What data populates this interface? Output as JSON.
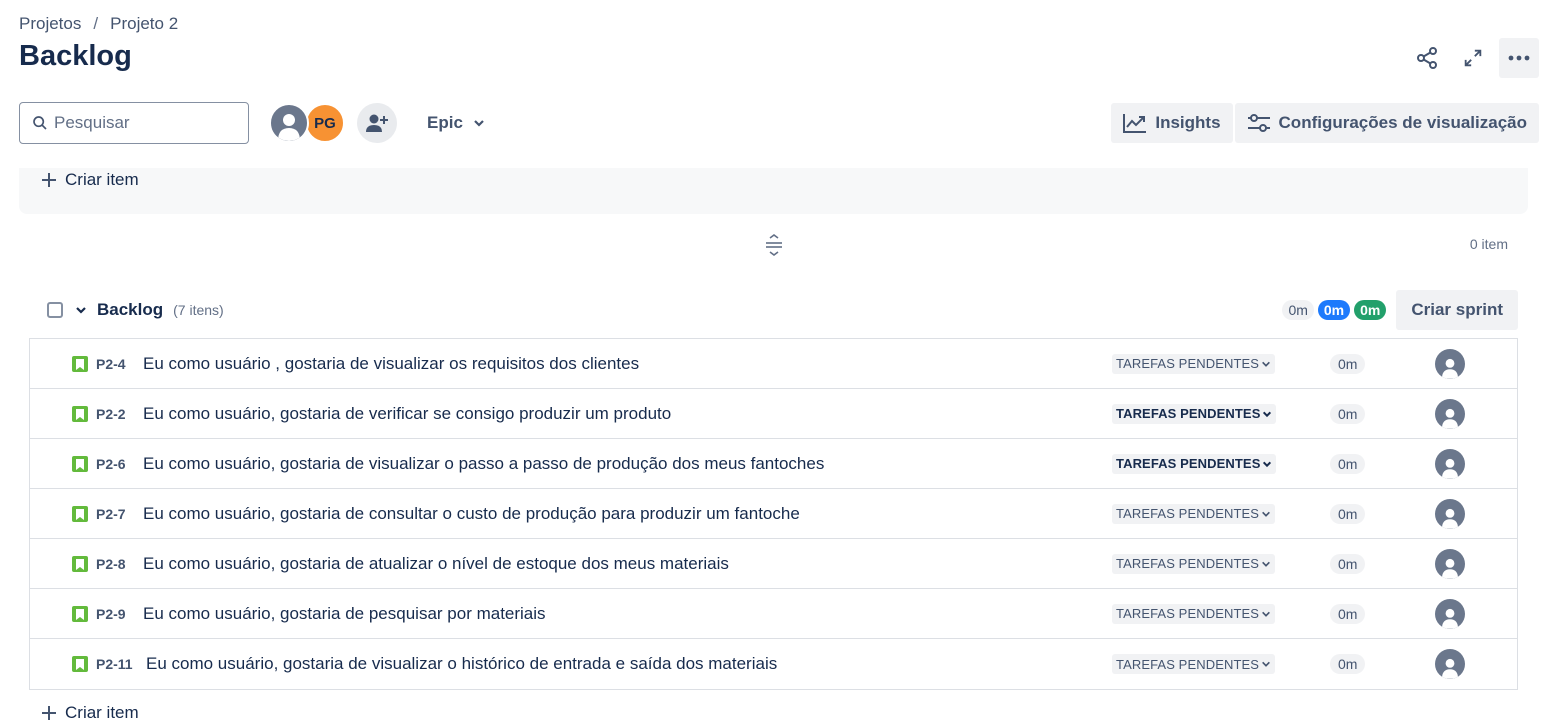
{
  "breadcrumb": {
    "projects": "Projetos",
    "separator": "/",
    "project": "Projeto 2"
  },
  "page": {
    "title": "Backlog"
  },
  "toolbar": {
    "search_placeholder": "Pesquisar",
    "avatar_initials": "PG",
    "epic_label": "Epic",
    "insights_label": "Insights",
    "view_settings_label": "Configurações de visualização"
  },
  "sprint_panel": {
    "create_item_label": "Criar item",
    "item_count": "0 item"
  },
  "backlog": {
    "title": "Backlog",
    "count": "(7 itens)",
    "estimate_todo": "0m",
    "estimate_in_progress": "0m",
    "estimate_done": "0m",
    "create_sprint_label": "Criar sprint",
    "create_item_label": "Criar item",
    "issues": [
      {
        "key": "P2-4",
        "summary": "Eu como usuário , gostaria de visualizar os requisitos dos clientes",
        "status": "TAREFAS PENDENTES",
        "estimate": "0m"
      },
      {
        "key": "P2-2",
        "summary": "Eu como usuário, gostaria de verificar se consigo produzir um produto",
        "status": "TAREFAS PENDENTES",
        "estimate": "0m"
      },
      {
        "key": "P2-6",
        "summary": "Eu como usuário, gostaria de visualizar o passo a passo de produção dos meus fantoches",
        "status": "TAREFAS PENDENTES",
        "estimate": "0m"
      },
      {
        "key": "P2-7",
        "summary": "Eu como usuário, gostaria de consultar o custo de produção para produzir um fantoche",
        "status": "TAREFAS PENDENTES",
        "estimate": "0m"
      },
      {
        "key": "P2-8",
        "summary": "Eu como usuário, gostaria de atualizar o nível de estoque dos meus materiais",
        "status": "TAREFAS PENDENTES",
        "estimate": "0m"
      },
      {
        "key": "P2-9",
        "summary": "Eu como usuário, gostaria de pesquisar por materiais",
        "status": "TAREFAS PENDENTES",
        "estimate": "0m"
      },
      {
        "key": "P2-11",
        "summary": "Eu como usuário, gostaria de visualizar o histórico de entrada e saída dos materiais",
        "status": "TAREFAS PENDENTES",
        "estimate": "0m"
      }
    ]
  },
  "colors": {
    "story_icon": "#63ba3c",
    "estimate_blue": "#1d7afc",
    "estimate_green": "#22a06b",
    "avatar_orange": "#f79233"
  }
}
